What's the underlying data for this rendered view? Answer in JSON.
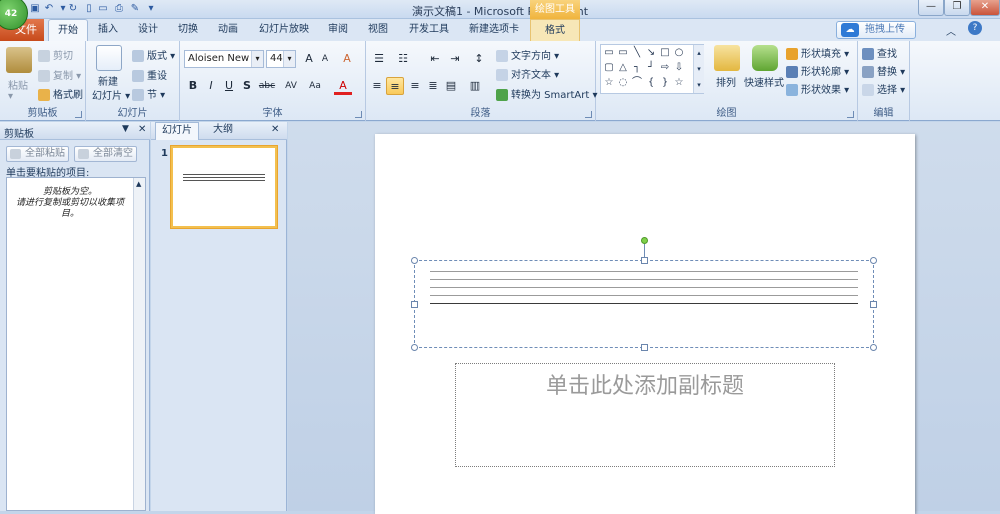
{
  "window": {
    "title": "演示文稿1 - Microsoft PowerPoint",
    "badge": "42",
    "contextual_header": "绘图工具"
  },
  "tabs": [
    {
      "label": "文件"
    },
    {
      "label": "开始"
    },
    {
      "label": "插入"
    },
    {
      "label": "设计"
    },
    {
      "label": "切换"
    },
    {
      "label": "动画"
    },
    {
      "label": "幻灯片放映"
    },
    {
      "label": "审阅"
    },
    {
      "label": "视图"
    },
    {
      "label": "开发工具"
    },
    {
      "label": "新建选项卡"
    },
    {
      "label": "格式"
    }
  ],
  "upload_label": "拖拽上传",
  "ribbon": {
    "clipboard": {
      "group": "剪贴板",
      "paste": "粘贴",
      "cut": "剪切",
      "copy": "复制",
      "format_painter": "格式刷"
    },
    "slides": {
      "group": "幻灯片",
      "new_slide_1": "新建",
      "new_slide_2": "幻灯片",
      "layout": "版式",
      "reset": "重设",
      "section": "节"
    },
    "font": {
      "group": "字体",
      "font_name": "Aloisen New",
      "font_size": "44",
      "grow": "A",
      "shrink": "A",
      "clear": "A",
      "bold": "B",
      "italic": "I",
      "underline": "U",
      "shadow": "S",
      "strike": "abc",
      "spacing": "AV",
      "case": "Aa",
      "color": "A"
    },
    "paragraph": {
      "group": "段落",
      "text_direction": "文字方向",
      "align_text": "对齐文本",
      "smartart": "转换为 SmartArt"
    },
    "drawing": {
      "group": "绘图",
      "arrange": "排列",
      "quick_styles": "快速样式",
      "shape_fill": "形状填充",
      "shape_outline": "形状轮廓",
      "shape_effects": "形状效果"
    },
    "editing": {
      "group": "编辑",
      "find": "查找",
      "replace": "替换",
      "select": "选择"
    }
  },
  "clipboard_pane": {
    "title": "剪贴板",
    "paste_all": "全部粘贴",
    "clear_all": "全部清空",
    "prompt": "单击要粘贴的项目:",
    "empty_line1": "剪贴板为空。",
    "empty_line2": "请进行复制或剪切以收集项",
    "empty_line3": "目。"
  },
  "slides_pane": {
    "tab_slides": "幻灯片",
    "tab_outline": "大纲",
    "slide_number": "1"
  },
  "slide": {
    "subtitle_placeholder": "单击此处添加副标题"
  },
  "colors": {
    "file_tab": "#c74a1b",
    "selection": "#f3c04f",
    "accent": "#2f7ad6"
  }
}
